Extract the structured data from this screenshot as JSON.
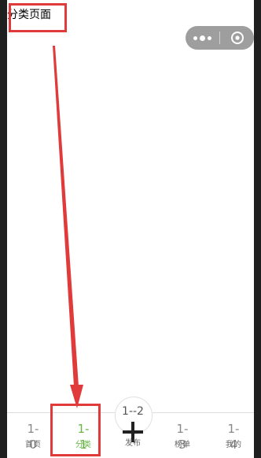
{
  "page": {
    "title": "分类页面"
  },
  "capsule": {
    "more_icon": "more-dots-icon",
    "close_icon": "target-circle-icon"
  },
  "tabbar": {
    "active_color": "#67b646",
    "items": [
      {
        "icon_text": "1-\n0",
        "label": "首页"
      },
      {
        "icon_text": "1-\n1",
        "label": "分类"
      },
      {
        "icon_text": "1-\n3",
        "label": "榜单"
      },
      {
        "icon_text": "1-\n4",
        "label": "我的"
      }
    ],
    "center": {
      "icon_text": "1--2",
      "label": "发布",
      "icon": "plus-icon"
    }
  },
  "annotation_color": "#e03a3a"
}
